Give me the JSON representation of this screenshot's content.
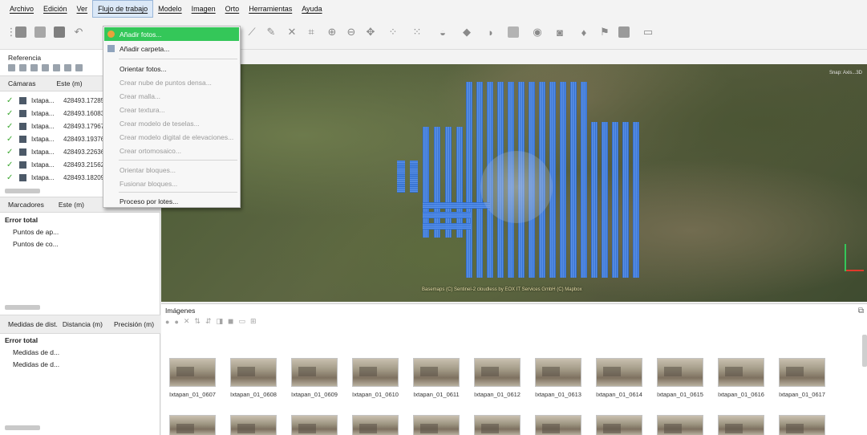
{
  "menubar": {
    "items": [
      "Archivo",
      "Edición",
      "Ver",
      "Flujo de trabajo",
      "Modelo",
      "Imagen",
      "Orto",
      "Herramientas",
      "Ayuda"
    ]
  },
  "dropdown": {
    "items": [
      {
        "label": "Añadir fotos...",
        "state": "highlighted"
      },
      {
        "label": "Añadir carpeta...",
        "state": "enabled"
      },
      {
        "label": "Orientar fotos...",
        "state": "enabled"
      },
      {
        "label": "Crear nube de puntos densa...",
        "state": "disabled"
      },
      {
        "label": "Crear malla...",
        "state": "disabled"
      },
      {
        "label": "Crear textura...",
        "state": "disabled"
      },
      {
        "label": "Crear modelo de teselas...",
        "state": "disabled"
      },
      {
        "label": "Crear modelo digital de elevaciones...",
        "state": "disabled"
      },
      {
        "label": "Crear ortomosaico...",
        "state": "disabled"
      },
      {
        "label": "Orientar bloques...",
        "state": "disabled"
      },
      {
        "label": "Fusionar bloques...",
        "state": "disabled"
      },
      {
        "label": "Proceso por lotes...",
        "state": "enabled"
      }
    ],
    "highlight_color": "#34c759"
  },
  "reference": {
    "title": "Referencia",
    "cameras_header": {
      "col1": "Cámaras",
      "col2": "Este (m)"
    },
    "cameras": [
      {
        "name": "Ixtapa...",
        "este": "428493.172850"
      },
      {
        "name": "Ixtapa...",
        "este": "428493.160836"
      },
      {
        "name": "Ixtapa...",
        "este": "428493.179672"
      },
      {
        "name": "Ixtapa...",
        "este": "428493.193769"
      },
      {
        "name": "Ixtapa...",
        "este": "428493.226361"
      },
      {
        "name": "Ixtapa...",
        "este": "428493.215628"
      },
      {
        "name": "Ixtapa...",
        "este": "428493.182092"
      }
    ],
    "markers_header": {
      "col1": "Marcadores",
      "col2": "Este (m)"
    },
    "markers": {
      "total": "Error total",
      "items": [
        "Puntos de ap...",
        "Puntos de co..."
      ]
    },
    "distances_header": {
      "col1": "Medidas de dist.",
      "col2": "Distancia (m)",
      "col3": "Precisión (m)"
    },
    "distances": {
      "total": "Error total",
      "items": [
        "Medidas de d...",
        "Medidas de d..."
      ]
    }
  },
  "map": {
    "attribution": "Basemaps (C) Sentinel-2 cloudless by EOX IT Services GmbH (C) Mapbox",
    "snap_label": "Snap: Axis...3D",
    "track_color": "#2f6fd6"
  },
  "images": {
    "title": "Imágenes",
    "thumbnails": [
      "Ixtapan_01_0607",
      "Ixtapan_01_0608",
      "Ixtapan_01_0609",
      "Ixtapan_01_0610",
      "Ixtapan_01_0611",
      "Ixtapan_01_0612",
      "Ixtapan_01_0613",
      "Ixtapan_01_0614",
      "Ixtapan_01_0615",
      "Ixtapan_01_0616",
      "Ixtapan_01_0617"
    ]
  }
}
